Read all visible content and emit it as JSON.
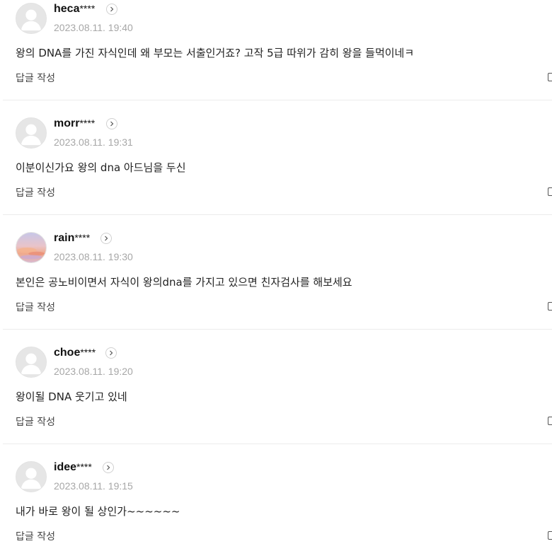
{
  "comments": [
    {
      "username": "heca",
      "masked": "****",
      "date": "2023.08.11. 19:40",
      "text": "왕의 DNA를 가진 자식인데 왜 부모는 서출인거죠? 고작 5급 따위가 감히 왕을 들먹이네ㅋ",
      "reply_label": "답글 작성",
      "avatar": "default-avatar-icon"
    },
    {
      "username": "morr",
      "masked": "****",
      "date": "2023.08.11. 19:31",
      "text": "이분이신가요 왕의 dna 아드님을 두신",
      "reply_label": "답글 작성",
      "avatar": "default-avatar-icon"
    },
    {
      "username": "rain",
      "masked": "****",
      "date": "2023.08.11. 19:30",
      "text": "본인은 공노비이면서 자식이 왕의dna를 가지고 있으면 친자검사를 해보세요",
      "reply_label": "답글 작성",
      "avatar": "sunset-photo-avatar"
    },
    {
      "username": "choe",
      "masked": "****",
      "date": "2023.08.11. 19:20",
      "text": "왕이될 DNA 웃기고 있네",
      "reply_label": "답글 작성",
      "avatar": "default-avatar-icon"
    },
    {
      "username": "idee",
      "masked": "****",
      "date": "2023.08.11. 19:15",
      "text": "내가 바로 왕이 될 상인가~~~~~~",
      "reply_label": "답글 작성",
      "avatar": "default-avatar-icon"
    }
  ],
  "colors": {
    "date": "#a7a7a7",
    "divider": "#ececec",
    "avatar_bg": "#e6e6e6"
  }
}
